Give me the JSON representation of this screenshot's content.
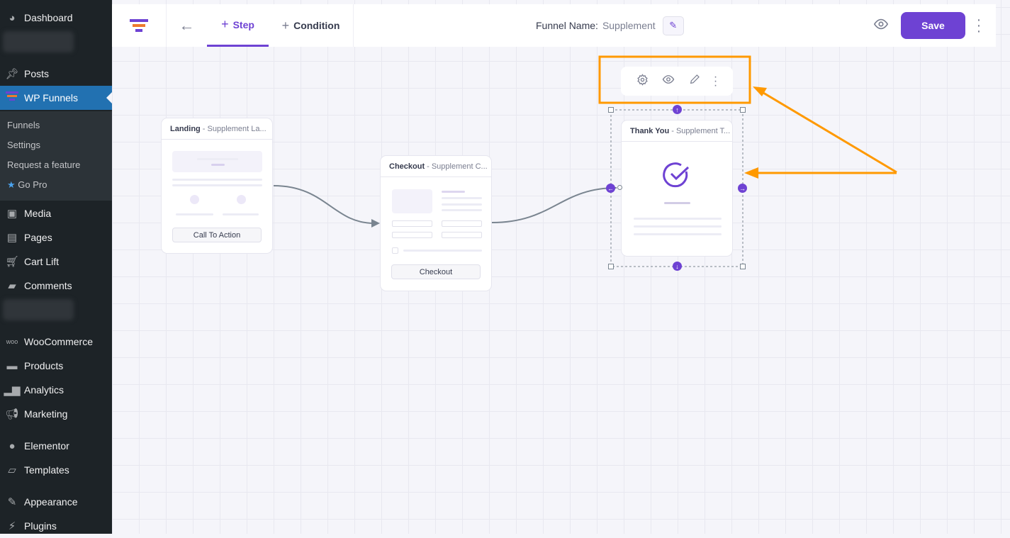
{
  "sidebar": {
    "items": [
      {
        "label": "Dashboard",
        "icon": "dashboard-icon"
      },
      {
        "label": "Posts",
        "icon": "pin-icon"
      },
      {
        "label": "WP Funnels",
        "icon": "funnel-icon"
      },
      {
        "label": "Media",
        "icon": "media-icon"
      },
      {
        "label": "Pages",
        "icon": "pages-icon"
      },
      {
        "label": "Cart Lift",
        "icon": "cart-icon"
      },
      {
        "label": "Comments",
        "icon": "comment-icon"
      },
      {
        "label": "WooCommerce",
        "icon": "woo-icon"
      },
      {
        "label": "Products",
        "icon": "archive-icon"
      },
      {
        "label": "Analytics",
        "icon": "bar-chart-icon"
      },
      {
        "label": "Marketing",
        "icon": "megaphone-icon"
      },
      {
        "label": "Elementor",
        "icon": "elementor-icon"
      },
      {
        "label": "Templates",
        "icon": "folder-icon"
      },
      {
        "label": "Appearance",
        "icon": "brush-icon"
      },
      {
        "label": "Plugins",
        "icon": "plug-icon"
      }
    ],
    "submenu": [
      "Funnels",
      "Settings",
      "Request a feature",
      "Go Pro"
    ]
  },
  "topbar": {
    "tabs": [
      {
        "label": "Step",
        "active": true
      },
      {
        "label": "Condition",
        "active": false
      }
    ],
    "funnel_name_label": "Funnel Name:",
    "funnel_name": "Supplement",
    "save_label": "Save"
  },
  "nodes": [
    {
      "type": "Landing",
      "name": "- Supplement La...",
      "button": "Call To Action"
    },
    {
      "type": "Checkout",
      "name": "- Supplement C...",
      "button": "Checkout"
    },
    {
      "type": "Thank You",
      "name": "- Supplement T..."
    }
  ],
  "colors": {
    "accent": "#6e42d3",
    "highlight": "#ff9900",
    "sidebar": "#1d2327",
    "active": "#2271b1"
  }
}
